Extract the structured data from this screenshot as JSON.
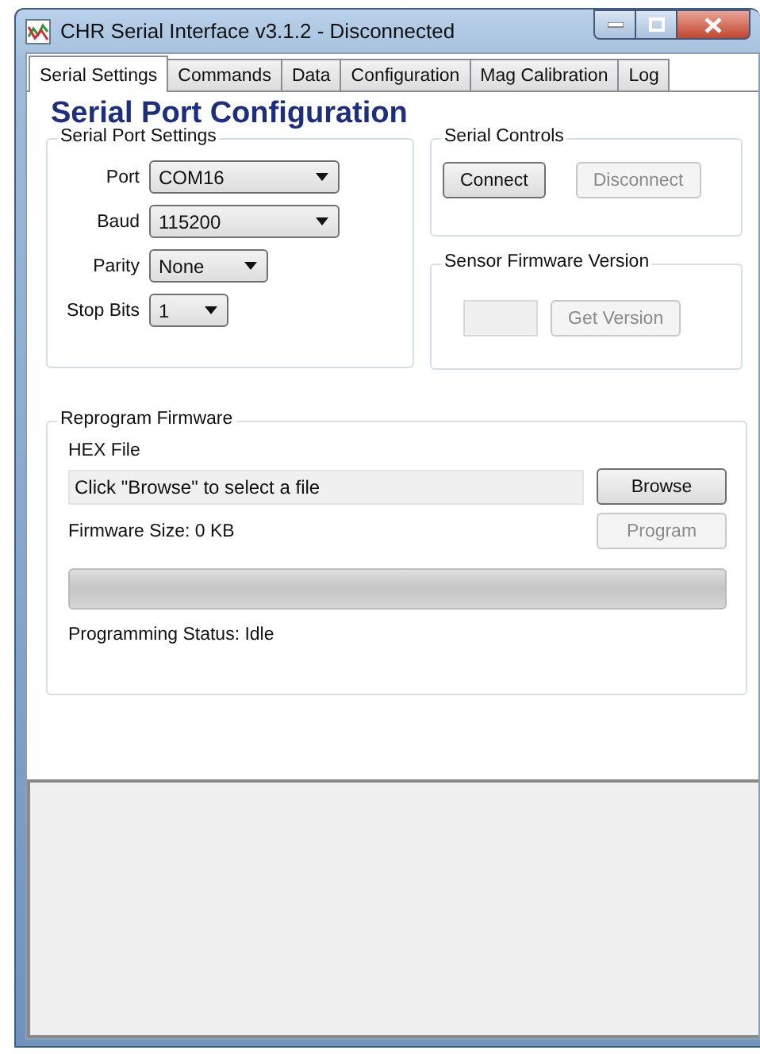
{
  "window": {
    "title": "CHR Serial Interface v3.1.2 - Disconnected"
  },
  "tabs": [
    {
      "label": "Serial Settings",
      "selected": true
    },
    {
      "label": "Commands",
      "selected": false
    },
    {
      "label": "Data",
      "selected": false
    },
    {
      "label": "Configuration",
      "selected": false
    },
    {
      "label": "Mag Calibration",
      "selected": false
    },
    {
      "label": "Log",
      "selected": false
    }
  ],
  "heading": "Serial Port Configuration",
  "serial_port_settings": {
    "title": "Serial Port Settings",
    "fields": [
      {
        "label": "Port",
        "value": "COM16"
      },
      {
        "label": "Baud",
        "value": "115200"
      },
      {
        "label": "Parity",
        "value": "None"
      },
      {
        "label": "Stop Bits",
        "value": "1"
      }
    ]
  },
  "serial_controls": {
    "title": "Serial Controls",
    "buttons": [
      {
        "label": "Connect",
        "disabled": false
      },
      {
        "label": "Disconnect",
        "disabled": true
      }
    ]
  },
  "firmware_version": {
    "title": "Sensor Firmware Version",
    "field": {
      "disabled": true
    },
    "button": {
      "label": "Get Version",
      "disabled": true
    }
  },
  "reprogram": {
    "title": "Reprogram Firmware",
    "hex_label": "HEX File",
    "file_field": {
      "value": "Click \"Browse\" to select a file"
    },
    "browse_button": {
      "label": "Browse",
      "disabled": false
    },
    "size_text": "Firmware Size: 0 KB",
    "program_button": {
      "label": "Program",
      "disabled": true
    },
    "progress": {
      "level": 0
    },
    "status_text": "Programming Status: Idle"
  }
}
